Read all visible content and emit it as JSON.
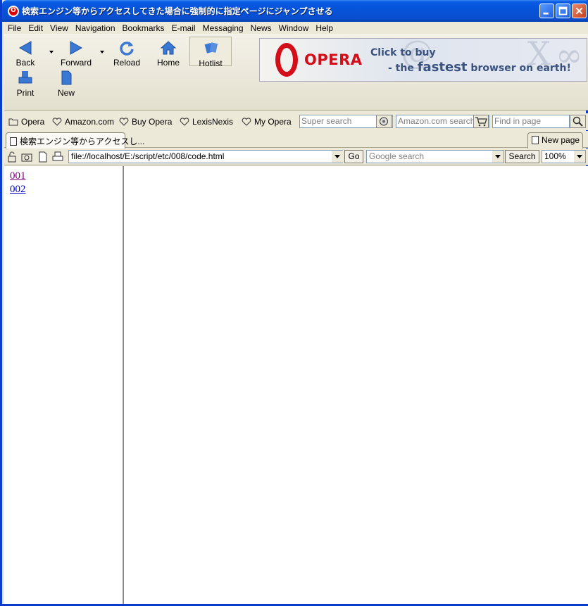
{
  "window": {
    "title": "検索エンジン等からアクセスしてきた場合に強制的に指定ページにジャンプさせる",
    "app_icon": "opera-icon",
    "controls": [
      "minimize",
      "maximize",
      "close"
    ]
  },
  "menu": [
    "File",
    "Edit",
    "View",
    "Navigation",
    "Bookmarks",
    "E-mail",
    "Messaging",
    "News",
    "Window",
    "Help"
  ],
  "toolbar": {
    "back": "Back",
    "forward": "Forward",
    "reload": "Reload",
    "home": "Home",
    "hotlist": "Hotlist",
    "print": "Print",
    "new": "New"
  },
  "banner": {
    "brand": "OPERA",
    "line1": "Click to buy",
    "line2_prefix": "- the",
    "line2_big": "fastest",
    "line2_suffix": "browser on earth!"
  },
  "personal_bar": {
    "items": [
      "Opera",
      "Amazon.com",
      "Buy Opera",
      "LexisNexis",
      "My Opera"
    ],
    "super_search_placeholder": "Super search",
    "amazon_search_placeholder": "Amazon.com search",
    "find_in_page_placeholder": "Find in page"
  },
  "tabs": {
    "active": "検索エンジン等からアクセスし...",
    "new_page": "New page"
  },
  "address_bar": {
    "url": "file://localhost/E:/script/etc/008/code.html",
    "go": "Go",
    "google_placeholder": "Google search",
    "search": "Search",
    "zoom": "100%"
  },
  "content": {
    "links": [
      {
        "label": "001",
        "visited": true
      },
      {
        "label": "002",
        "visited": false
      }
    ]
  },
  "colors": {
    "titlebar": "#0553d9",
    "chrome": "#ece9d8",
    "visited_link": "#800080",
    "link": "#0000cc",
    "opera_red": "#d40e18"
  }
}
